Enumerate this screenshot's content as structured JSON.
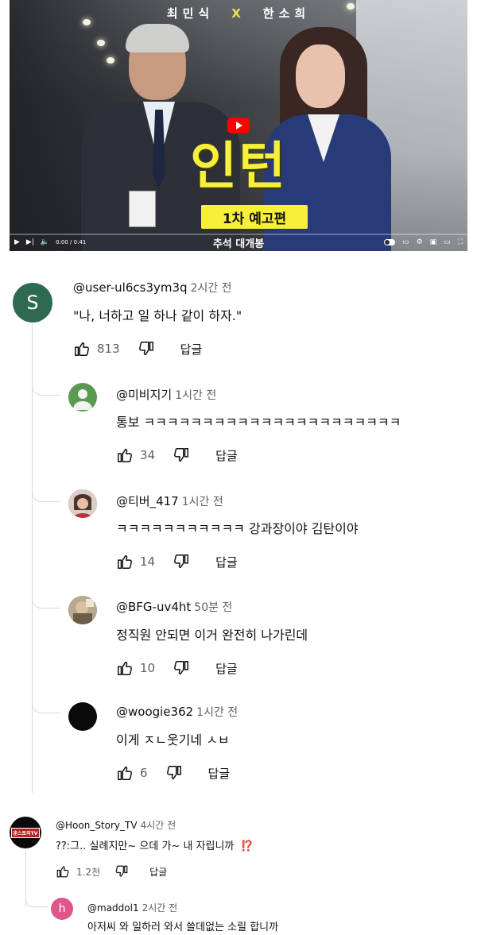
{
  "video": {
    "cast_left": "최민식",
    "cast_x": "X",
    "cast_right": "한소희",
    "title": "인턴",
    "subtitle": "1차 예고편",
    "caption": "추석 대개봉",
    "time": "0:00 / 0:41",
    "progress": 0
  },
  "comments": [
    {
      "handle": "@user-ul6cs3ym3q",
      "time": "2시간 전",
      "text": "\"나, 너하고 일 하나 같이 하자.\"",
      "likes": "813",
      "reply_label": "답글",
      "avatar_letter": "S",
      "avatar_color": "#2e6a50"
    },
    {
      "handle": "@미비지기",
      "time": "1시간 전",
      "text": "통보 ㅋㅋㅋㅋㅋㅋㅋㅋㅋㅋㅋㅋㅋㅋㅋㅋㅋㅋㅋㅋㅋㅋ",
      "likes": "34",
      "reply_label": "답글",
      "avatar_color": "#5a9a52"
    },
    {
      "handle": "@티버_417",
      "time": "1시간 전",
      "text": "ㅋㅋㅋㅋㅋㅋㅋㅋㅋㅋㅋ 강과장이야 김탄이야",
      "likes": "14",
      "reply_label": "답글",
      "avatar_color": "#c63a44"
    },
    {
      "handle": "@BFG-uv4ht",
      "time": "50분 전",
      "text": "정직원 안되면 이거 완전히 나가린데",
      "likes": "10",
      "reply_label": "답글",
      "avatar_color": "#9a8a70"
    },
    {
      "handle": "@woogie362",
      "time": "1시간 전",
      "text": "이게 ㅈㄴ웃기네 ㅅㅂ",
      "likes": "6",
      "reply_label": "답글",
      "avatar_color": "#0a0a0a"
    },
    {
      "handle": "@Hoon_Story_TV",
      "time": "4시간 전",
      "text": "??:그.. 실례지만~ 으데 가~ 내 자립니까",
      "text_emoji": "⁉️",
      "likes": "1.2천",
      "reply_label": "답글",
      "avatar_label": "훈스토리TV",
      "avatar_color": "#0a0a0a"
    },
    {
      "handle": "@maddol1",
      "time": "2시간 전",
      "text": "아저씨 와 일하러 와서 쓸데없는 소릴 합니까",
      "avatar_letter": "h",
      "avatar_color": "#e0568a"
    }
  ]
}
